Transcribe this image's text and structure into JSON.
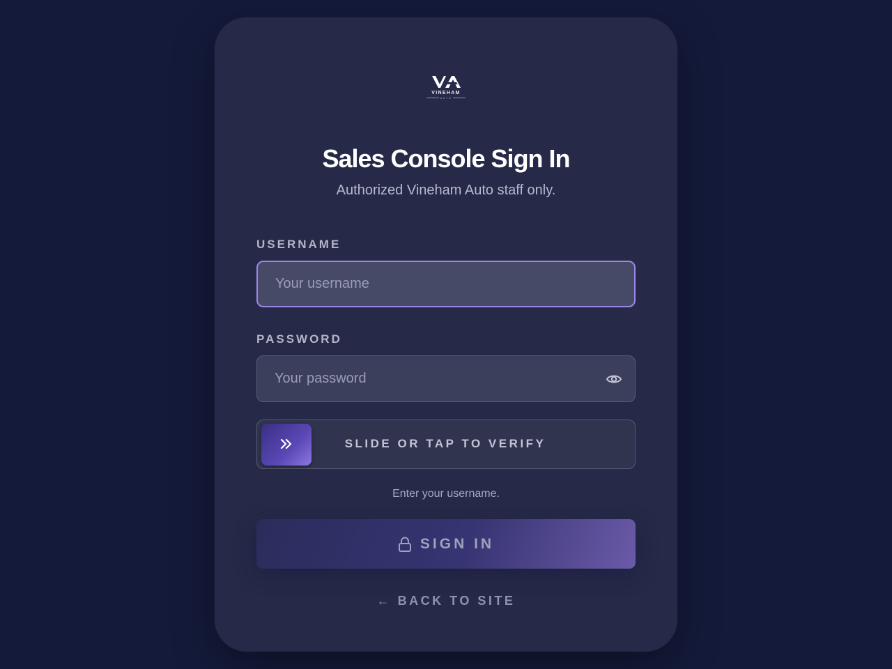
{
  "logo": {
    "mark": "VA",
    "wordmark": "VINEHAM",
    "sub": "AUTO"
  },
  "title": "Sales Console Sign In",
  "subtitle": "Authorized Vineham Auto staff only.",
  "username": {
    "label": "USERNAME",
    "placeholder": "Your username",
    "value": ""
  },
  "password": {
    "label": "PASSWORD",
    "placeholder": "Your password",
    "value": "",
    "toggle_icon": "eye-icon"
  },
  "verify": {
    "label": "SLIDE OR TAP TO VERIFY",
    "knob_icon": "double-chevron-right-icon"
  },
  "hint": "Enter your username.",
  "signin": {
    "label": "SIGN IN",
    "icon": "lock-icon"
  },
  "back_link": "← BACK TO SITE",
  "colors": {
    "background": "#141a3a",
    "card": "#262a48",
    "accent": "#9b87e6",
    "button_gradient_start": "#2c2c5c",
    "button_gradient_end": "#6b5aa8"
  }
}
